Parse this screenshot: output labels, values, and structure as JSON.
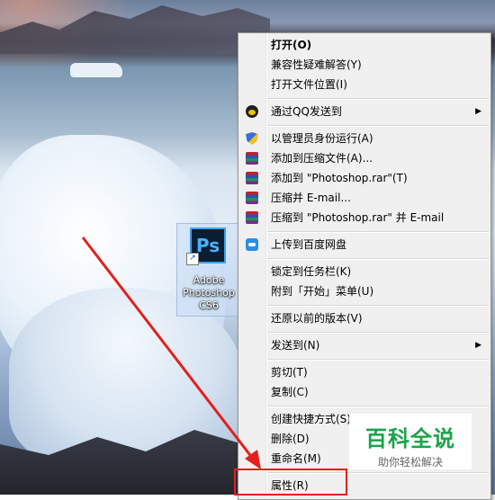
{
  "desktop_icon": {
    "label": "Adobe\nPhotoshop\nCS6",
    "logo_text": "Ps",
    "icon": "photoshop-icon"
  },
  "context_menu": {
    "items": [
      {
        "label": "打开(O)",
        "bold": true
      },
      {
        "label": "兼容性疑难解答(Y)"
      },
      {
        "label": "打开文件位置(I)"
      },
      {
        "label": "通过QQ发送到",
        "icon": "qq-icon",
        "submenu": true
      },
      {
        "label": "以管理员身份运行(A)",
        "icon": "uac-shield-icon"
      },
      {
        "label": "添加到压缩文件(A)...",
        "icon": "winrar-icon"
      },
      {
        "label": "添加到 \"Photoshop.rar\"(T)",
        "icon": "winrar-icon"
      },
      {
        "label": "压缩并 E-mail...",
        "icon": "winrar-icon"
      },
      {
        "label": "压缩到 \"Photoshop.rar\" 并 E-mail",
        "icon": "winrar-icon"
      },
      {
        "label": "上传到百度网盘",
        "icon": "baidu-cloud-icon"
      },
      {
        "label": "锁定到任务栏(K)"
      },
      {
        "label": "附到「开始」菜单(U)"
      },
      {
        "label": "还原以前的版本(V)"
      },
      {
        "label": "发送到(N)",
        "submenu": true
      },
      {
        "label": "剪切(T)"
      },
      {
        "label": "复制(C)"
      },
      {
        "label": "创建快捷方式(S)"
      },
      {
        "label": "删除(D)"
      },
      {
        "label": "重命名(M)"
      },
      {
        "label": "属性(R)"
      }
    ]
  },
  "watermark": {
    "title": "百科全说",
    "subtitle": "助你轻松解决"
  },
  "colors": {
    "annotation": "#e3201b",
    "watermark_green": "#1aa34a"
  }
}
